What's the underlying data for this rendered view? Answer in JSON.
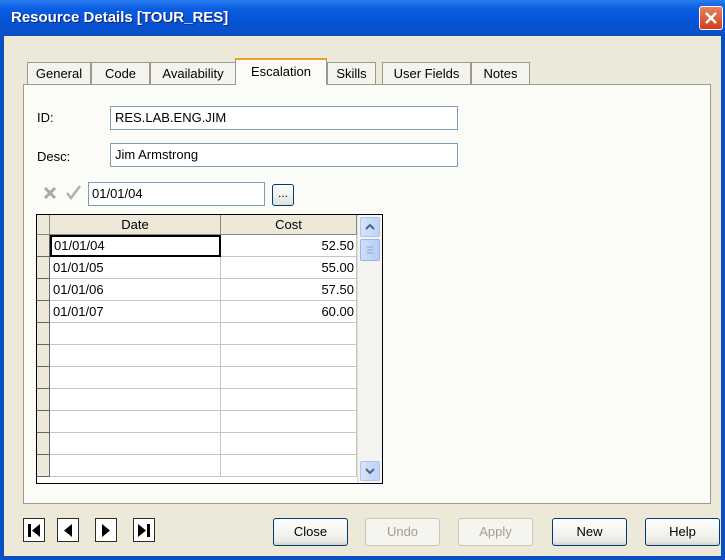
{
  "window": {
    "title": "Resource Details [TOUR_RES]"
  },
  "tabs": [
    {
      "label": "General",
      "active": false
    },
    {
      "label": "Code",
      "active": false
    },
    {
      "label": "Availability",
      "active": false
    },
    {
      "label": "Escalation",
      "active": true
    },
    {
      "label": "Skills",
      "active": false
    },
    {
      "label": "User Fields",
      "active": false
    },
    {
      "label": "Notes",
      "active": false
    }
  ],
  "form": {
    "id_label": "ID:",
    "id_value": "RES.LAB.ENG.JIM",
    "desc_label": "Desc:",
    "desc_value": "Jim Armstrong"
  },
  "editor": {
    "current_value": "01/01/04",
    "ellipsis_label": "..."
  },
  "grid": {
    "columns": [
      "Date",
      "Cost"
    ],
    "rows": [
      {
        "date": "01/01/04",
        "cost": "52.50"
      },
      {
        "date": "01/01/05",
        "cost": "55.00"
      },
      {
        "date": "01/01/06",
        "cost": "57.50"
      },
      {
        "date": "01/01/07",
        "cost": "60.00"
      }
    ]
  },
  "buttons": {
    "close": "Close",
    "undo": "Undo",
    "apply": "Apply",
    "new": "New",
    "help": "Help"
  },
  "icons": {
    "window_close": "close-icon",
    "cancel_edit": "x-icon",
    "confirm_edit": "check-icon",
    "nav": [
      "first-record-icon",
      "prev-record-icon",
      "next-record-icon",
      "last-record-icon"
    ]
  }
}
